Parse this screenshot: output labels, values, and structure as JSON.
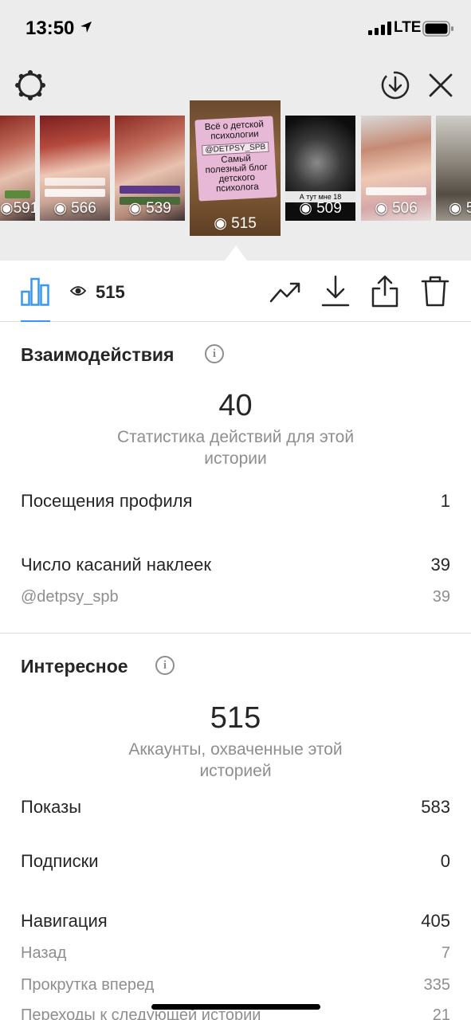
{
  "status_bar": {
    "time": "13:50",
    "network": "LTE"
  },
  "colors": {
    "accent": "#3897f0",
    "text": "#262626",
    "secondary": "#8e8e8e"
  },
  "stories": [
    {
      "views": "591",
      "visual": "face"
    },
    {
      "views": "566",
      "visual": "face"
    },
    {
      "views": "539",
      "visual": "face"
    },
    {
      "views": "515",
      "visual": "pink-card",
      "selected": true,
      "card_lines": [
        "Всё о детской",
        "психологии",
        "@DETPSY_SPB",
        "Самый",
        "полезный блог",
        "детского",
        "психолога"
      ]
    },
    {
      "views": "509",
      "visual": "night",
      "caption": "А тут мне 18"
    },
    {
      "views": "506",
      "visual": "face"
    },
    {
      "views": "5",
      "visual": "object"
    }
  ],
  "toolbar": {
    "views": "515"
  },
  "interactions": {
    "title": "Взаимодействия",
    "total": "40",
    "subtitle": "Статистика действий для этой истории",
    "rows": [
      {
        "label": "Посещения профиля",
        "value": "1"
      },
      {
        "label": "Число касаний наклеек",
        "value": "39"
      }
    ],
    "subrows": [
      {
        "label": "@detpsy_spb",
        "value": "39"
      }
    ]
  },
  "discovery": {
    "title": "Интересное",
    "total": "515",
    "subtitle": "Аккаунты, охваченные этой историей",
    "rows": [
      {
        "label": "Показы",
        "value": "583"
      },
      {
        "label": "Подписки",
        "value": "0"
      },
      {
        "label": "Навигация",
        "value": "405"
      }
    ],
    "subrows": [
      {
        "label": "Назад",
        "value": "7"
      },
      {
        "label": "Прокрутка вперед",
        "value": "335"
      },
      {
        "label": "Переходы к следующей истории",
        "value": "21"
      }
    ]
  }
}
